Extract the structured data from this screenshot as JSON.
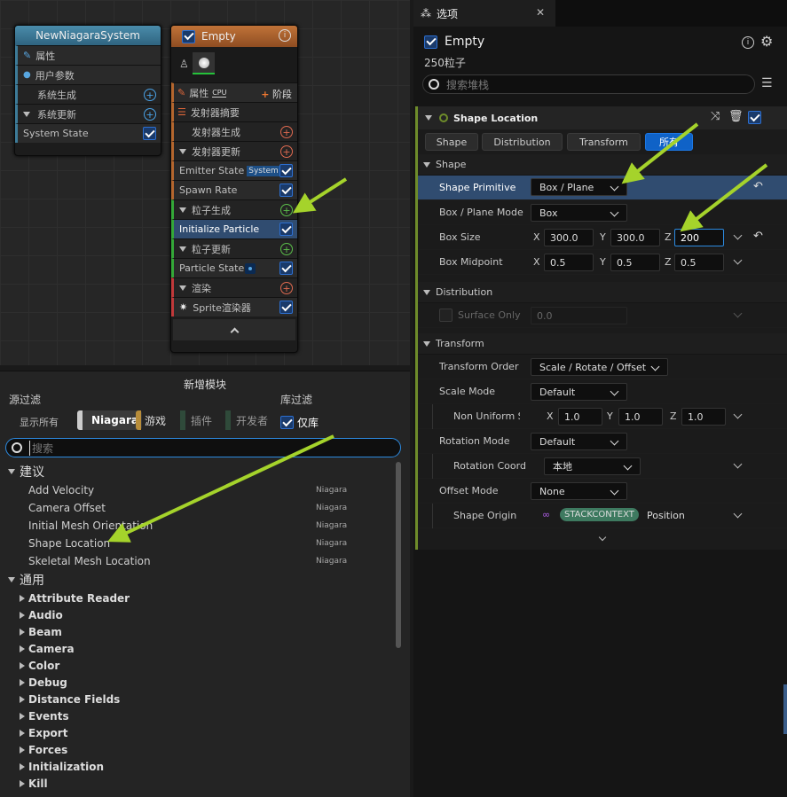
{
  "graph": {
    "system_node": {
      "title": "NewNiagaraSystem",
      "rows": [
        "属性",
        "用户参数",
        "系统生成",
        "系统更新",
        "System State"
      ]
    },
    "emitter_node": {
      "title": "Empty",
      "props_label": "属性",
      "cpu_badge": "CPU",
      "stage_label": "阶段",
      "summary": "发射器摘要",
      "emitter_spawn": "发射器生成",
      "emitter_update": "发射器更新",
      "emitter_state": "Emitter State",
      "system_badge": "System",
      "spawn_rate": "Spawn Rate",
      "particle_spawn": "粒子生成",
      "initialize_particle": "Initialize Particle",
      "particle_update": "粒子更新",
      "particle_state": "Particle State",
      "render": "渲染",
      "sprite_renderer": "Sprite渲染器"
    }
  },
  "library": {
    "title": "新增模块",
    "source_filter": "源过滤",
    "lib_filter": "库过滤",
    "filters": [
      "显示所有",
      "Niagara",
      "游戏",
      "插件",
      "开发者"
    ],
    "only_library": "仅库",
    "search_placeholder": "搜索",
    "suggested_header": "建议",
    "suggested": [
      {
        "name": "Add Velocity",
        "tag": "Niagara"
      },
      {
        "name": "Camera Offset",
        "tag": "Niagara"
      },
      {
        "name": "Initial Mesh Orientation",
        "tag": "Niagara"
      },
      {
        "name": "Shape Location",
        "tag": "Niagara"
      },
      {
        "name": "Skeletal Mesh Location",
        "tag": "Niagara"
      }
    ],
    "general_header": "通用",
    "categories": [
      "Attribute Reader",
      "Audio",
      "Beam",
      "Camera",
      "Color",
      "Debug",
      "Distance Fields",
      "Events",
      "Export",
      "Forces",
      "Initialization",
      "Kill"
    ]
  },
  "panel": {
    "tab_title": "选项",
    "emitter_name": "Empty",
    "particle_count": "250粒子",
    "search_placeholder": "搜索堆栈",
    "module_title": "Shape Location",
    "tabs": [
      "Shape",
      "Distribution",
      "Transform",
      "所有"
    ],
    "shape_section": "Shape",
    "shape_primitive_label": "Shape Primitive",
    "shape_primitive_value": "Box / Plane",
    "box_plane_mode_label": "Box / Plane Mode",
    "box_plane_mode_value": "Box",
    "box_size_label": "Box Size",
    "box_size": {
      "x": "300.0",
      "y": "300.0",
      "z": "200"
    },
    "box_midpoint_label": "Box Midpoint",
    "box_midpoint": {
      "x": "0.5",
      "y": "0.5",
      "z": "0.5"
    },
    "distribution_section": "Distribution",
    "surface_only_label": "Surface Only",
    "surface_only_value": "0.0",
    "transform_section": "Transform",
    "transform_order_label": "Transform Order",
    "transform_order_value": "Scale / Rotate / Offset",
    "scale_mode_label": "Scale Mode",
    "scale_mode_value": "Default",
    "non_uniform_label": "Non Uniform S",
    "non_uniform": {
      "x": "1.0",
      "y": "1.0",
      "z": "1.0"
    },
    "rotation_mode_label": "Rotation Mode",
    "rotation_mode_value": "Default",
    "rotation_coord_label": "Rotation Coord",
    "rotation_coord_value": "本地",
    "offset_mode_label": "Offset Mode",
    "offset_mode_value": "None",
    "shape_origin_label": "Shape Origin",
    "stackcontext": "STACKCONTEXT",
    "shape_origin_value": "Position",
    "axis_x": "X",
    "axis_y": "Y",
    "axis_z": "Z"
  },
  "colors": {
    "accent_blue": "#0f62c7",
    "arrow": "#a5d32b",
    "emitter_orange": "#b4662e",
    "system_teal": "#3d7b98"
  }
}
